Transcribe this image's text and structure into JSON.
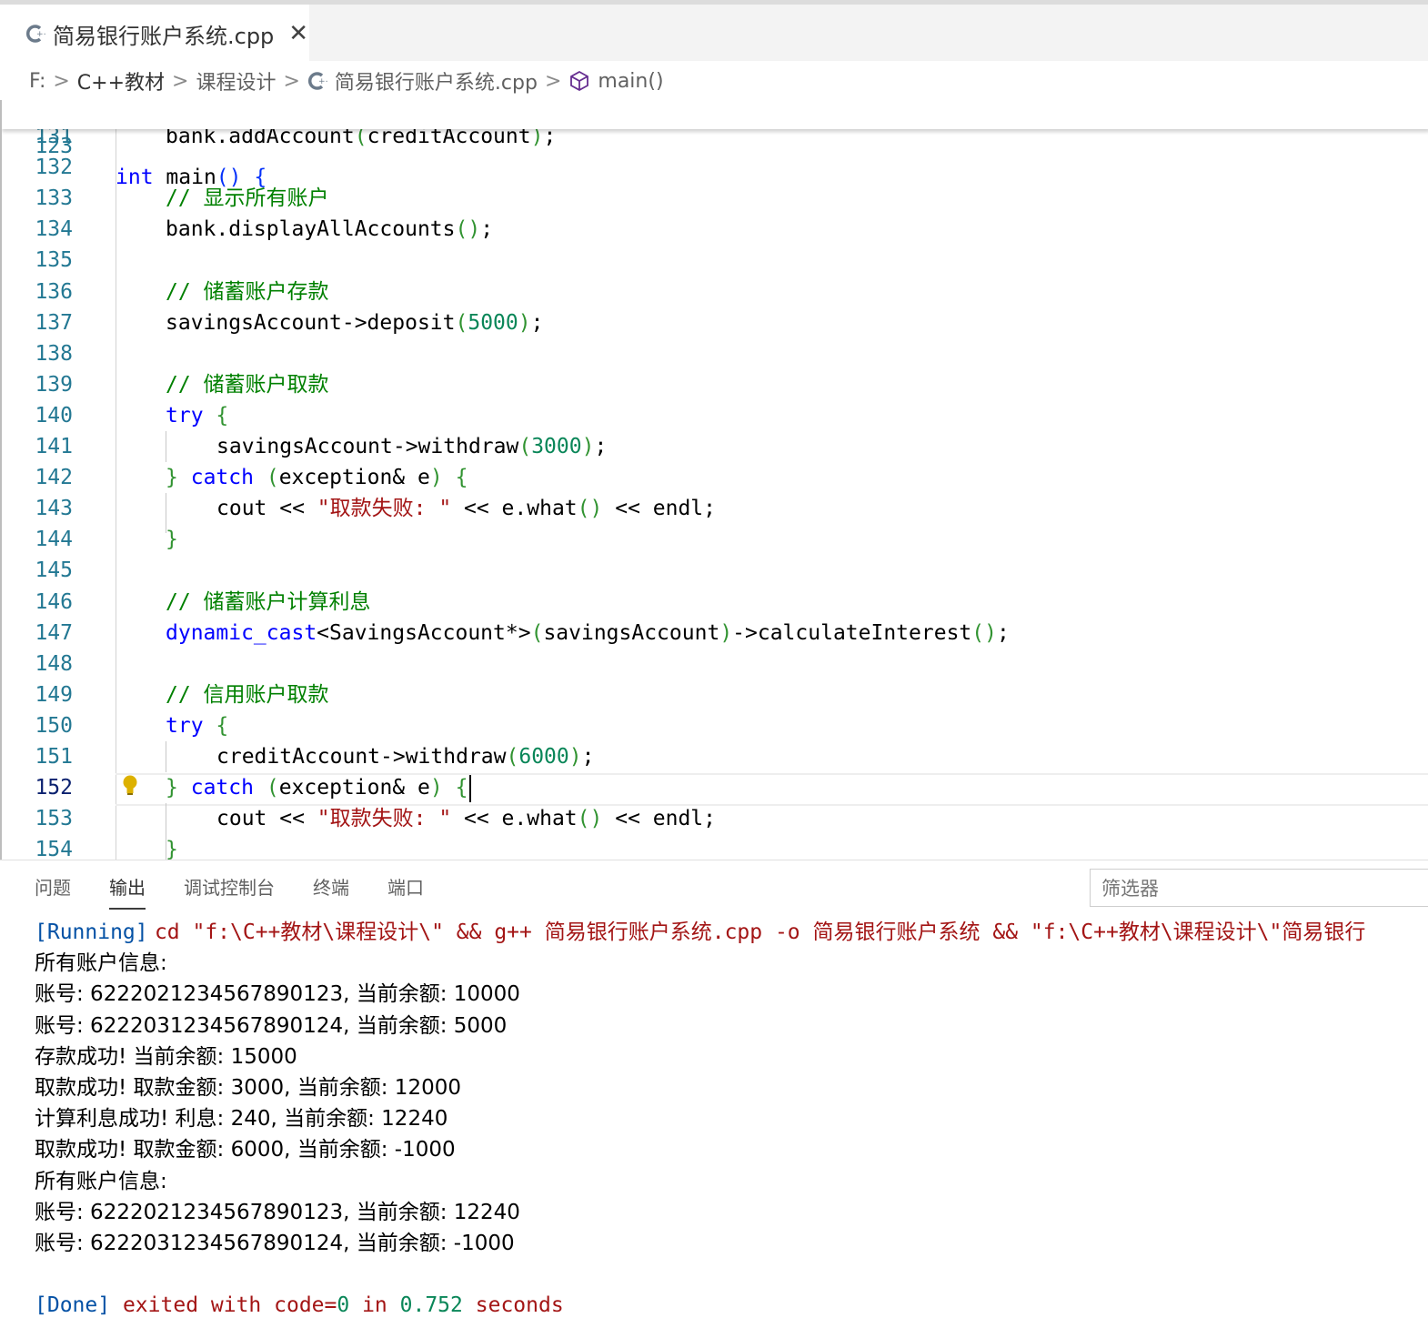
{
  "tab": {
    "title": "简易银行账户系统.cpp",
    "close": "✕",
    "icon": "cpp-file-icon"
  },
  "breadcrumb": {
    "items": [
      "F:",
      "C++教材",
      "课程设计",
      "简易银行账户系统.cpp",
      "main()"
    ],
    "separator": ">"
  },
  "sticky": {
    "line_number": "123",
    "keyword": "int",
    "name": "main",
    "parens": "()",
    "brace": "{"
  },
  "code_lines": [
    {
      "n": "131",
      "text": "bank.addAccount(creditAccount);"
    },
    {
      "n": "132",
      "text": ""
    },
    {
      "n": "133",
      "text": "// 显示所有账户"
    },
    {
      "n": "134",
      "text": "bank.displayAllAccounts();"
    },
    {
      "n": "135",
      "text": ""
    },
    {
      "n": "136",
      "text": "// 储蓄账户存款"
    },
    {
      "n": "137",
      "text": "savingsAccount->deposit(5000);"
    },
    {
      "n": "138",
      "text": ""
    },
    {
      "n": "139",
      "text": "// 储蓄账户取款"
    },
    {
      "n": "140",
      "text": "try {"
    },
    {
      "n": "141",
      "text": "savingsAccount->withdraw(3000);"
    },
    {
      "n": "142",
      "text": "} catch (exception& e) {"
    },
    {
      "n": "143",
      "text": "cout << \"取款失败: \" << e.what() << endl;"
    },
    {
      "n": "144",
      "text": "}"
    },
    {
      "n": "145",
      "text": ""
    },
    {
      "n": "146",
      "text": "// 储蓄账户计算利息"
    },
    {
      "n": "147",
      "text": "dynamic_cast<SavingsAccount*>(savingsAccount)->calculateInterest();"
    },
    {
      "n": "148",
      "text": ""
    },
    {
      "n": "149",
      "text": "// 信用账户取款"
    },
    {
      "n": "150",
      "text": "try {"
    },
    {
      "n": "151",
      "text": "creditAccount->withdraw(6000);"
    },
    {
      "n": "152",
      "text": "} catch (exception& e) {"
    },
    {
      "n": "153",
      "text": "cout << \"取款失败: \" << e.what() << endl;"
    },
    {
      "n": "154",
      "text": "}"
    }
  ],
  "panel": {
    "tabs": [
      "问题",
      "输出",
      "调试控制台",
      "终端",
      "端口"
    ],
    "active_tab": "输出",
    "filter_placeholder": "筛选器"
  },
  "output": {
    "running_tag": "[Running]",
    "running_cmd": "cd \"f:\\C++教材\\课程设计\\\" && g++ 简易银行账户系统.cpp -o 简易银行账户系统 && \"f:\\C++教材\\课程设计\\\"简易银行",
    "lines": [
      "所有账户信息:",
      "账号: 6222021234567890123, 当前余额: 10000",
      "账号: 6222031234567890124, 当前余额: 5000",
      "存款成功! 当前余额: 15000",
      "取款成功! 取款金额: 3000, 当前余额: 12000",
      "计算利息成功! 利息: 240, 当前余额: 12240",
      "取款成功! 取款金额: 6000, 当前余额: -1000",
      "所有账户信息:",
      "账号: 6222021234567890123, 当前余额: 12240",
      "账号: 6222031234567890124, 当前余额: -1000",
      ""
    ],
    "done_tag": "[Done]",
    "done_text_1": "exited with code=",
    "done_code": "0",
    "done_text_2": "in",
    "done_time": "0.752",
    "done_text_3": "seconds"
  },
  "colors": {
    "keyword": "#0000ff",
    "comment": "#008000",
    "number": "#098658",
    "string": "#a31515",
    "line_number": "#237893"
  }
}
